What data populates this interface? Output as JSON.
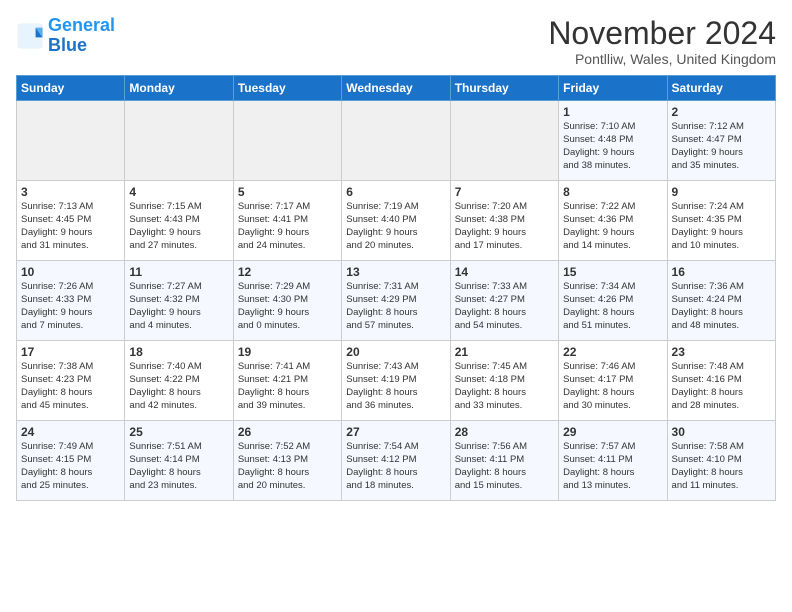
{
  "logo": {
    "line1": "General",
    "line2": "Blue"
  },
  "title": "November 2024",
  "subtitle": "Pontlliw, Wales, United Kingdom",
  "weekdays": [
    "Sunday",
    "Monday",
    "Tuesday",
    "Wednesday",
    "Thursday",
    "Friday",
    "Saturday"
  ],
  "weeks": [
    [
      {
        "day": "",
        "info": ""
      },
      {
        "day": "",
        "info": ""
      },
      {
        "day": "",
        "info": ""
      },
      {
        "day": "",
        "info": ""
      },
      {
        "day": "",
        "info": ""
      },
      {
        "day": "1",
        "info": "Sunrise: 7:10 AM\nSunset: 4:48 PM\nDaylight: 9 hours\nand 38 minutes."
      },
      {
        "day": "2",
        "info": "Sunrise: 7:12 AM\nSunset: 4:47 PM\nDaylight: 9 hours\nand 35 minutes."
      }
    ],
    [
      {
        "day": "3",
        "info": "Sunrise: 7:13 AM\nSunset: 4:45 PM\nDaylight: 9 hours\nand 31 minutes."
      },
      {
        "day": "4",
        "info": "Sunrise: 7:15 AM\nSunset: 4:43 PM\nDaylight: 9 hours\nand 27 minutes."
      },
      {
        "day": "5",
        "info": "Sunrise: 7:17 AM\nSunset: 4:41 PM\nDaylight: 9 hours\nand 24 minutes."
      },
      {
        "day": "6",
        "info": "Sunrise: 7:19 AM\nSunset: 4:40 PM\nDaylight: 9 hours\nand 20 minutes."
      },
      {
        "day": "7",
        "info": "Sunrise: 7:20 AM\nSunset: 4:38 PM\nDaylight: 9 hours\nand 17 minutes."
      },
      {
        "day": "8",
        "info": "Sunrise: 7:22 AM\nSunset: 4:36 PM\nDaylight: 9 hours\nand 14 minutes."
      },
      {
        "day": "9",
        "info": "Sunrise: 7:24 AM\nSunset: 4:35 PM\nDaylight: 9 hours\nand 10 minutes."
      }
    ],
    [
      {
        "day": "10",
        "info": "Sunrise: 7:26 AM\nSunset: 4:33 PM\nDaylight: 9 hours\nand 7 minutes."
      },
      {
        "day": "11",
        "info": "Sunrise: 7:27 AM\nSunset: 4:32 PM\nDaylight: 9 hours\nand 4 minutes."
      },
      {
        "day": "12",
        "info": "Sunrise: 7:29 AM\nSunset: 4:30 PM\nDaylight: 9 hours\nand 0 minutes."
      },
      {
        "day": "13",
        "info": "Sunrise: 7:31 AM\nSunset: 4:29 PM\nDaylight: 8 hours\nand 57 minutes."
      },
      {
        "day": "14",
        "info": "Sunrise: 7:33 AM\nSunset: 4:27 PM\nDaylight: 8 hours\nand 54 minutes."
      },
      {
        "day": "15",
        "info": "Sunrise: 7:34 AM\nSunset: 4:26 PM\nDaylight: 8 hours\nand 51 minutes."
      },
      {
        "day": "16",
        "info": "Sunrise: 7:36 AM\nSunset: 4:24 PM\nDaylight: 8 hours\nand 48 minutes."
      }
    ],
    [
      {
        "day": "17",
        "info": "Sunrise: 7:38 AM\nSunset: 4:23 PM\nDaylight: 8 hours\nand 45 minutes."
      },
      {
        "day": "18",
        "info": "Sunrise: 7:40 AM\nSunset: 4:22 PM\nDaylight: 8 hours\nand 42 minutes."
      },
      {
        "day": "19",
        "info": "Sunrise: 7:41 AM\nSunset: 4:21 PM\nDaylight: 8 hours\nand 39 minutes."
      },
      {
        "day": "20",
        "info": "Sunrise: 7:43 AM\nSunset: 4:19 PM\nDaylight: 8 hours\nand 36 minutes."
      },
      {
        "day": "21",
        "info": "Sunrise: 7:45 AM\nSunset: 4:18 PM\nDaylight: 8 hours\nand 33 minutes."
      },
      {
        "day": "22",
        "info": "Sunrise: 7:46 AM\nSunset: 4:17 PM\nDaylight: 8 hours\nand 30 minutes."
      },
      {
        "day": "23",
        "info": "Sunrise: 7:48 AM\nSunset: 4:16 PM\nDaylight: 8 hours\nand 28 minutes."
      }
    ],
    [
      {
        "day": "24",
        "info": "Sunrise: 7:49 AM\nSunset: 4:15 PM\nDaylight: 8 hours\nand 25 minutes."
      },
      {
        "day": "25",
        "info": "Sunrise: 7:51 AM\nSunset: 4:14 PM\nDaylight: 8 hours\nand 23 minutes."
      },
      {
        "day": "26",
        "info": "Sunrise: 7:52 AM\nSunset: 4:13 PM\nDaylight: 8 hours\nand 20 minutes."
      },
      {
        "day": "27",
        "info": "Sunrise: 7:54 AM\nSunset: 4:12 PM\nDaylight: 8 hours\nand 18 minutes."
      },
      {
        "day": "28",
        "info": "Sunrise: 7:56 AM\nSunset: 4:11 PM\nDaylight: 8 hours\nand 15 minutes."
      },
      {
        "day": "29",
        "info": "Sunrise: 7:57 AM\nSunset: 4:11 PM\nDaylight: 8 hours\nand 13 minutes."
      },
      {
        "day": "30",
        "info": "Sunrise: 7:58 AM\nSunset: 4:10 PM\nDaylight: 8 hours\nand 11 minutes."
      }
    ]
  ]
}
